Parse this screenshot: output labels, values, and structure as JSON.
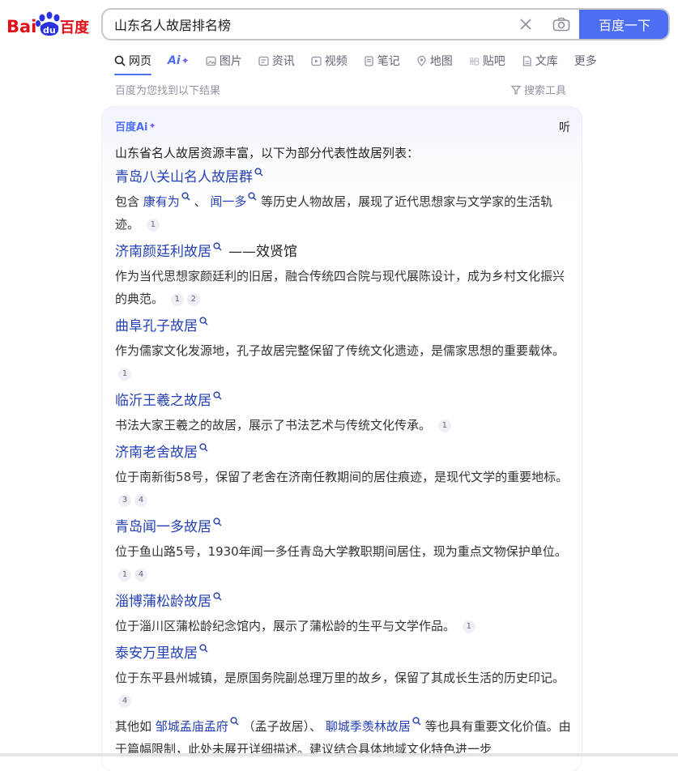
{
  "logo": {
    "text_left": "Bai",
    "text_paw": "du",
    "text_right": "百度"
  },
  "search": {
    "query": "山东名人故居排名榜",
    "button_label": "百度一下"
  },
  "tabs": [
    {
      "label": "网页",
      "icon": "search-icon"
    },
    {
      "label": "Ai",
      "icon": "ai-sparkle-icon"
    },
    {
      "label": "图片",
      "icon": "image-icon"
    },
    {
      "label": "资讯",
      "icon": "news-icon"
    },
    {
      "label": "视频",
      "icon": "video-icon"
    },
    {
      "label": "笔记",
      "icon": "note-icon"
    },
    {
      "label": "地图",
      "icon": "map-icon"
    },
    {
      "label": "贴吧",
      "icon": "tieba-icon"
    },
    {
      "label": "文库",
      "icon": "doc-icon"
    },
    {
      "label": "更多",
      "icon": ""
    }
  ],
  "result_info": {
    "count_text": "百度为您找到以下结果",
    "tools_label": "搜索工具"
  },
  "ai_card": {
    "brand": "百度Ai",
    "listen_label": "听",
    "intro": "山东省名人故居资源丰富，以下为部分代表性故居列表：",
    "items": [
      {
        "title": "青岛八关山名人故居群",
        "desc_pre": "包含 ",
        "link1": "康有为",
        "sep": " 、 ",
        "link2": "闻一多",
        "desc_post": " 等历史人物故居，展现了近代思想家与文学家的生活轨迹。",
        "cites": [
          "1"
        ]
      },
      {
        "title": "济南颜廷利故居",
        "suffix": "——效贤馆",
        "desc": "作为当代思想家颜廷利的旧居，融合传统四合院与现代展陈设计，成为乡村文化振兴的典范。",
        "cites": [
          "1",
          "2"
        ]
      },
      {
        "title": "曲阜孔子故居",
        "desc": "作为儒家文化发源地，孔子故居完整保留了传统文化遗迹，是儒家思想的重要载体。",
        "cites": [
          "1"
        ]
      },
      {
        "title": "临沂王羲之故居",
        "desc": "书法大家王羲之的故居，展示了书法艺术与传统文化传承。",
        "cites": [
          "1"
        ]
      },
      {
        "title": "济南老舍故居",
        "desc": "位于南新街58号，保留了老舍在济南任教期间的居住痕迹，是现代文学的重要地标。",
        "cites": [
          "3",
          "4"
        ]
      },
      {
        "title": "青岛闻一多故居",
        "desc": "位于鱼山路5号，1930年闻一多任青岛大学教职期间居住，现为重点文物保护单位。",
        "cites": [
          "1",
          "4"
        ]
      },
      {
        "title": "淄博蒲松龄故居",
        "desc": "位于淄川区蒲松龄纪念馆内，展示了蒲松龄的生平与文学作品。",
        "cites": [
          "1"
        ]
      },
      {
        "title": "泰安万里故居",
        "desc": "位于东平县州城镇，是原国务院副总理万里的故乡，保留了其成长生活的历史印记。",
        "cites": [
          "4"
        ]
      }
    ],
    "outro": {
      "pre": "其他如 ",
      "link1": "邹城孟庙孟府",
      "mid": " （孟子故居）、 ",
      "link2": "聊城季羡林故居",
      "post": " 等也具有重要文化价值。由于篇幅限制，此处未展开详细描述。建议结合具体地域文化特色进一步"
    }
  },
  "colors": {
    "accent": "#4e6ef2",
    "link": "#2440b3",
    "brand_red": "#de0f17",
    "brand_blue": "#2932e1"
  }
}
